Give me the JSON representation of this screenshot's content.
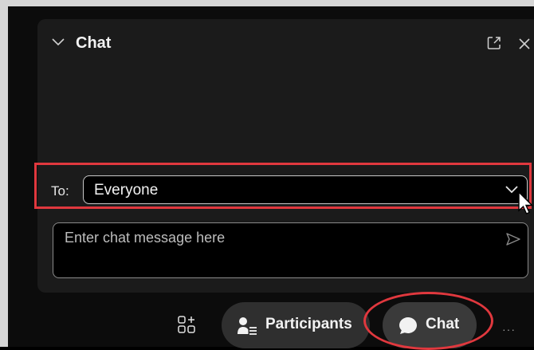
{
  "chat_panel": {
    "title": "Chat",
    "to_label": "To:",
    "recipient": "Everyone",
    "message_placeholder": "Enter chat message here"
  },
  "toolbar": {
    "participants_label": "Participants",
    "chat_label": "Chat",
    "more_label": "···"
  },
  "icons": {
    "collapse": "chevron-down-icon",
    "popout": "popout-icon",
    "close": "close-icon",
    "dropdown": "chevron-down-icon",
    "send": "send-icon",
    "apps": "apps-icon",
    "participants": "participants-icon",
    "chat": "chat-bubble-icon",
    "more": "more-icon"
  },
  "colors": {
    "background": "#0c0c0c",
    "panel": "#1b1b1b",
    "highlight": "#e0383e",
    "pill": "#2f2f2f"
  }
}
